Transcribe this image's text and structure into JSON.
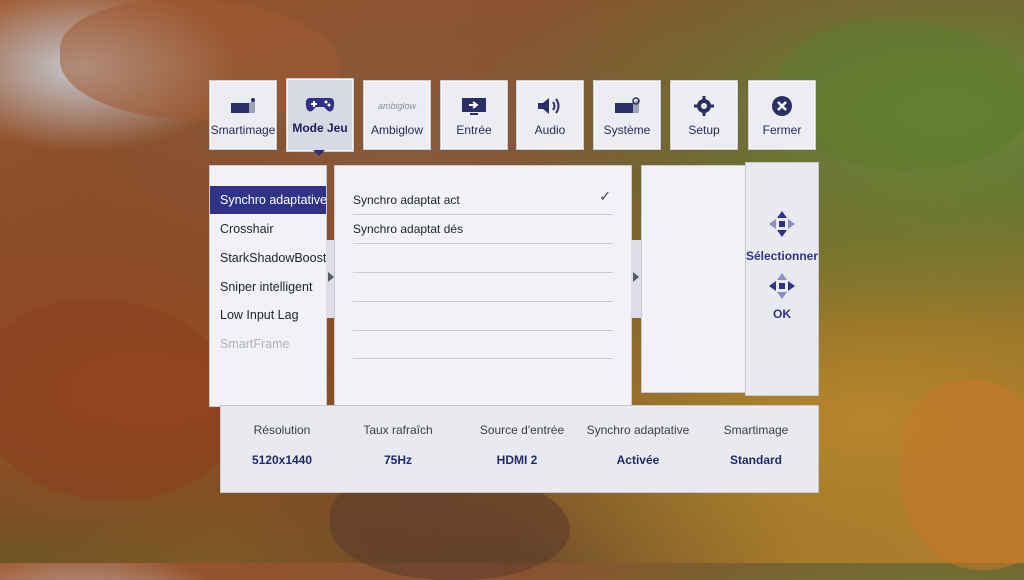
{
  "top_tabs": [
    {
      "label": "Smartimage",
      "icon": "smartimage-icon"
    },
    {
      "label": "Mode Jeu",
      "icon": "gamepad-icon"
    },
    {
      "label": "Ambiglow",
      "icon": "ambiglow-icon",
      "logo_text": "ambiglow"
    },
    {
      "label": "Entrée",
      "icon": "input-icon"
    },
    {
      "label": "Audio",
      "icon": "speaker-icon"
    },
    {
      "label": "Système",
      "icon": "system-icon"
    },
    {
      "label": "Setup",
      "icon": "gear-icon"
    },
    {
      "label": "Fermer",
      "icon": "close-icon"
    }
  ],
  "active_tab": "Mode Jeu",
  "left_menu": [
    {
      "label": "Synchro adaptative",
      "state": "selected"
    },
    {
      "label": "Crosshair",
      "state": "normal"
    },
    {
      "label": "StarkShadowBoost",
      "state": "normal"
    },
    {
      "label": "Sniper intelligent",
      "state": "normal"
    },
    {
      "label": "Low Input Lag",
      "state": "normal"
    },
    {
      "label": "SmartFrame",
      "state": "disabled"
    }
  ],
  "options": [
    {
      "label": "Synchro adaptat act",
      "checked": true
    },
    {
      "label": "Synchro adaptat dés",
      "checked": false
    },
    {
      "label": ""
    },
    {
      "label": ""
    },
    {
      "label": ""
    },
    {
      "label": ""
    }
  ],
  "check_glyph": "✓",
  "nav": {
    "select_label": "Sélectionner",
    "ok_label": "OK"
  },
  "info": [
    {
      "header": "Résolution",
      "value": "5120x1440"
    },
    {
      "header": "Taux rafraîch",
      "value": "75Hz"
    },
    {
      "header": "Source d'entrée",
      "value": "HDMI 2"
    },
    {
      "header": "Synchro adaptative",
      "value": "Activée"
    },
    {
      "header": "Smartimage",
      "value": "Standard"
    }
  ],
  "colors": {
    "accent": "#2f3287",
    "panel": "#f1f2f6",
    "text": "#1e2230"
  }
}
